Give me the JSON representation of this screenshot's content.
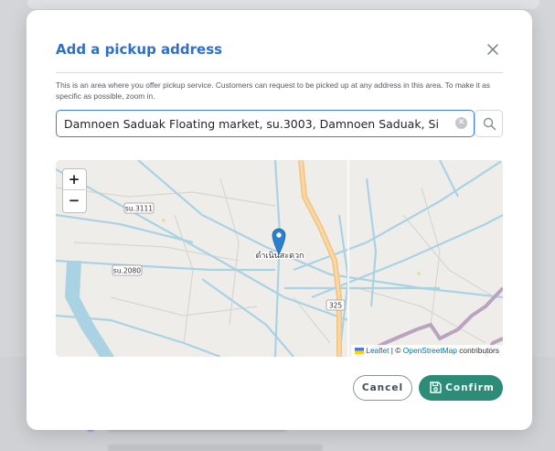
{
  "modal": {
    "title": "Add a pickup address",
    "description": "This is an area where you offer pickup service. Customers can request to be picked up at any address in this area. To make it as specific as possible, zoom in.",
    "close_icon": "close-icon",
    "search": {
      "value": "Damnoen Saduak Floating market, su.3003, Damnoen Saduak, Si",
      "clear_icon": "clear-icon",
      "search_icon": "search-icon"
    },
    "map": {
      "zoom_in_label": "+",
      "zoom_out_label": "−",
      "attribution": {
        "leaflet": "Leaflet",
        "separator": " | © ",
        "osm": "OpenStreetMap",
        "suffix": " contributors"
      },
      "labels": {
        "road_3111": "su.3111",
        "road_2080": "su.2080",
        "road_325": "325",
        "place": "ดำเนินสะดวก"
      }
    },
    "buttons": {
      "cancel": "Cancel",
      "confirm": "Confirm"
    }
  },
  "colors": {
    "accent": "#2f6fc9",
    "confirm": "#2c8c77",
    "marker": "#2a81cb"
  }
}
